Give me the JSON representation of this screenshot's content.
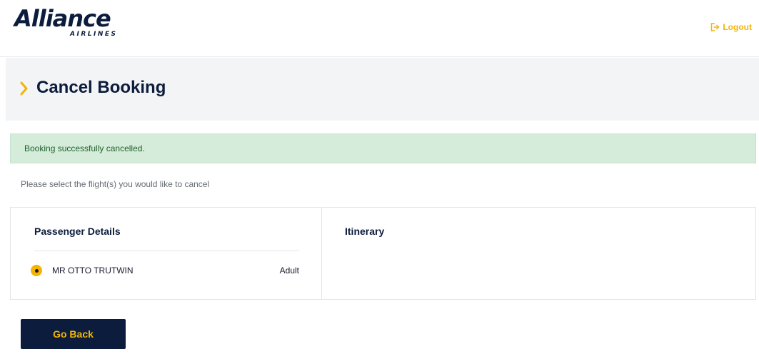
{
  "header": {
    "logo_main": "Alliance",
    "logo_sub": "AIRLINES",
    "logout_label": "Logout",
    "logout_icon": "logout-icon"
  },
  "page": {
    "title": "Cancel Booking",
    "title_icon": "chevron-right-icon"
  },
  "alert": {
    "message": "Booking successfully cancelled.",
    "type": "success"
  },
  "instruction": "Please select the flight(s) you would like to cancel",
  "passenger_details": {
    "heading": "Passenger Details",
    "passengers": [
      {
        "name": "MR OTTO TRUTWIN",
        "type": "Adult",
        "selected": true
      }
    ]
  },
  "itinerary": {
    "heading": "Itinerary"
  },
  "actions": {
    "go_back_label": "Go Back"
  },
  "colors": {
    "brand_navy": "#0c1c3c",
    "accent_yellow": "#f4b400",
    "success_bg": "#d4ecd9",
    "success_text": "#1f5f2e",
    "band_bg": "#f3f4f6"
  }
}
